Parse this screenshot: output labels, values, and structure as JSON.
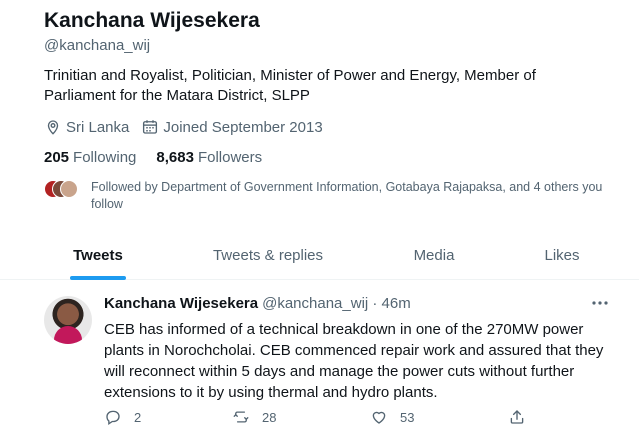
{
  "profile": {
    "name": "Kanchana Wijesekera",
    "handle": "@kanchana_wij",
    "bio": "Trinitian and Royalist, Politician, Minister of Power and Energy, Member of Parliament for the Matara District, SLPP",
    "location": "Sri Lanka",
    "joined": "Joined September 2013",
    "following_count": "205",
    "following_label": "Following",
    "followers_count": "8,683",
    "followers_label": "Followers",
    "followed_by": "Followed by Department of Government Information, Gotabaya Rajapaksa, and 4 others you follow"
  },
  "tabs": [
    {
      "label": "Tweets",
      "active": true
    },
    {
      "label": "Tweets & replies",
      "active": false
    },
    {
      "label": "Media",
      "active": false
    },
    {
      "label": "Likes",
      "active": false
    }
  ],
  "tweet": {
    "author": "Kanchana Wijesekera",
    "handle_time": "@kanchana_wij · 46m",
    "text": "CEB has informed of a technical breakdown in one of the 270MW power plants in Norochcholai. CEB commenced repair work and assured that they will reconnect within 5 days and manage the power cuts without further extensions to it by using thermal and hydro plants.",
    "replies": "2",
    "retweets": "28",
    "likes": "53"
  },
  "colors": {
    "accent": "#1d9bf0",
    "secondary_text": "#536471",
    "primary_text": "#0f1419"
  },
  "icons": [
    "location-icon",
    "calendar-icon",
    "more-icon",
    "reply-icon",
    "retweet-icon",
    "like-icon",
    "share-icon"
  ]
}
